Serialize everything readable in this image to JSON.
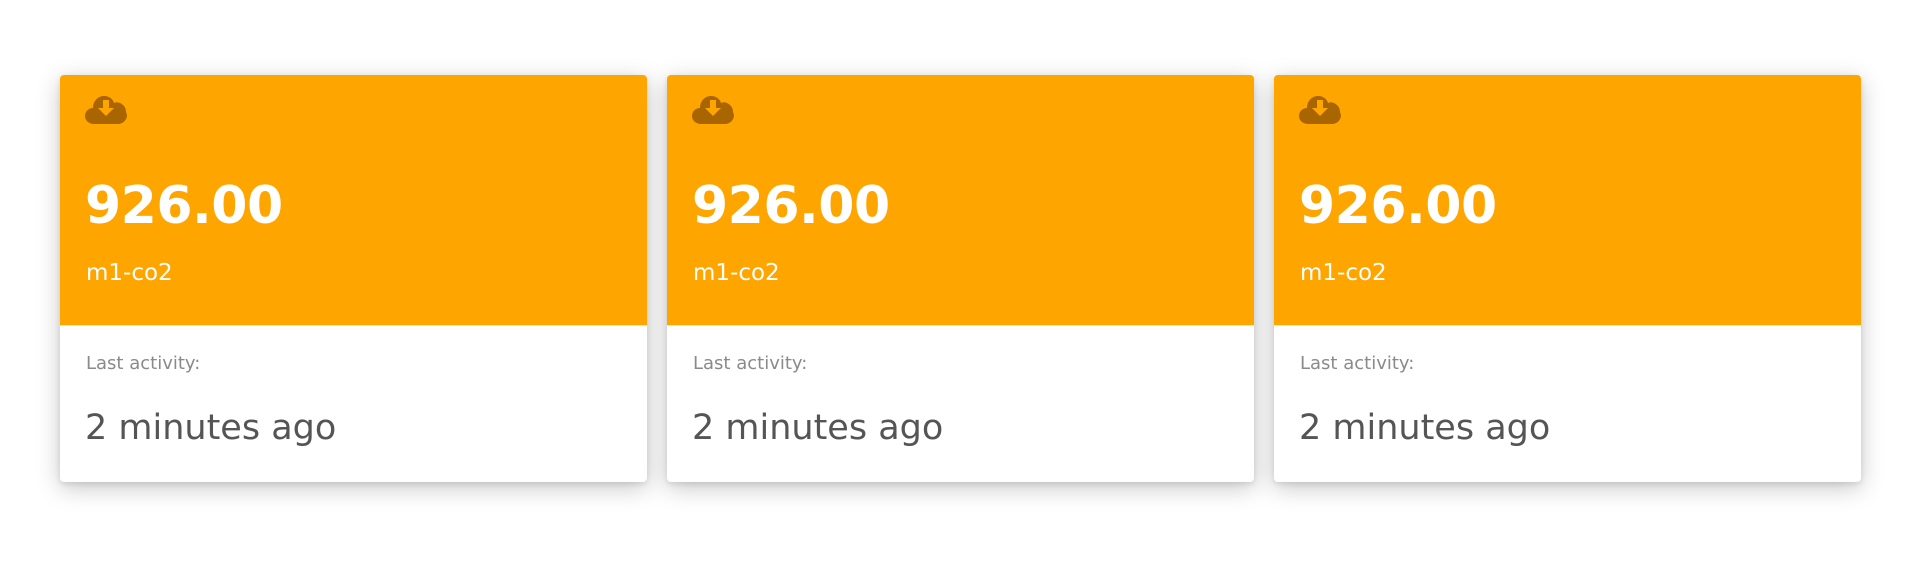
{
  "theme": {
    "accent": "#FFA500",
    "icon_color": "#A86500"
  },
  "cards": [
    {
      "icon": "cloud-download-icon",
      "value": "926.00",
      "label": "m1-co2",
      "activity_label": "Last activity:",
      "activity_value": "2 minutes ago"
    },
    {
      "icon": "cloud-download-icon",
      "value": "926.00",
      "label": "m1-co2",
      "activity_label": "Last activity:",
      "activity_value": "2 minutes ago"
    },
    {
      "icon": "cloud-download-icon",
      "value": "926.00",
      "label": "m1-co2",
      "activity_label": "Last activity:",
      "activity_value": "2 minutes ago"
    }
  ]
}
